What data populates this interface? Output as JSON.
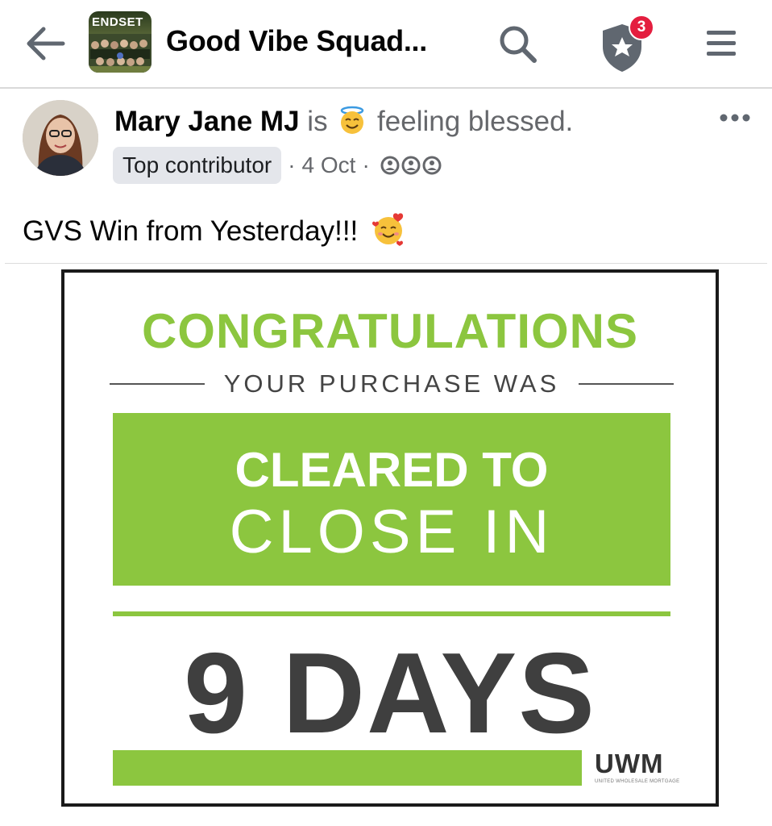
{
  "header": {
    "group_title": "Good Vibe Squad...",
    "thumb_text": "ENDSET",
    "notification_count": "3"
  },
  "post": {
    "author": "Mary Jane MJ",
    "is_text": "is",
    "feeling": "feeling blessed.",
    "badge": "Top contributor",
    "sep1": "·",
    "date": "4 Oct",
    "sep2": "·",
    "text": "GVS Win from Yesterday!!!"
  },
  "image_card": {
    "headline": "CONGRATULATIONS",
    "subline": "YOUR PURCHASE WAS",
    "box_line1": "CLEARED TO",
    "box_line2": "CLOSE IN",
    "big_text": "9 DAYS",
    "brand": "UWM",
    "brand_tagline": "UNITED WHOLESALE MORTGAGE"
  },
  "colors": {
    "accent_green": "#8cc63f",
    "notification_red": "#e41e3f",
    "icon_gray": "#606770"
  },
  "icons": [
    "back-arrow-icon",
    "search-icon",
    "badge-star-icon",
    "hamburger-menu-icon",
    "more-options-icon",
    "halo-smile-emoji-icon",
    "smiling-hearts-emoji-icon",
    "group-audience-icon"
  ]
}
